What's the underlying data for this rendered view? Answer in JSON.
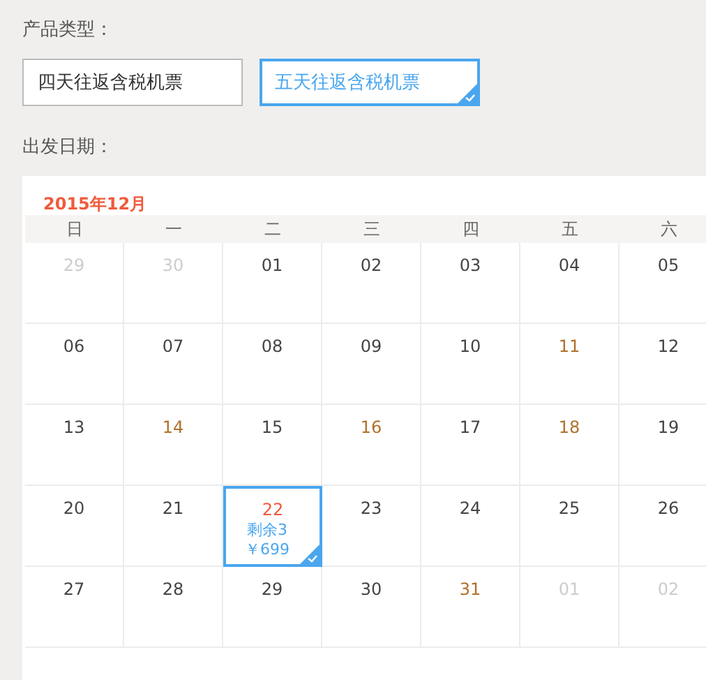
{
  "product_label": "产品类型：",
  "products": [
    {
      "label": "四天往返含税机票",
      "selected": false
    },
    {
      "label": "五天往返含税机票",
      "selected": true
    }
  ],
  "date_label": "出发日期：",
  "calendar": {
    "month": "2015年12月",
    "weekdays": [
      "日",
      "一",
      "二",
      "三",
      "四",
      "五",
      "六"
    ],
    "days": [
      {
        "day": "29",
        "kind": "muted",
        "selected": false
      },
      {
        "day": "30",
        "kind": "muted",
        "selected": false
      },
      {
        "day": "01",
        "kind": "plain",
        "selected": false
      },
      {
        "day": "02",
        "kind": "plain",
        "selected": false
      },
      {
        "day": "03",
        "kind": "plain",
        "selected": false
      },
      {
        "day": "04",
        "kind": "plain",
        "selected": false
      },
      {
        "day": "05",
        "kind": "plain",
        "selected": false
      },
      {
        "day": "06",
        "kind": "plain",
        "selected": false
      },
      {
        "day": "07",
        "kind": "plain",
        "selected": false
      },
      {
        "day": "08",
        "kind": "plain",
        "selected": false
      },
      {
        "day": "09",
        "kind": "plain",
        "selected": false
      },
      {
        "day": "10",
        "kind": "plain",
        "selected": false
      },
      {
        "day": "11",
        "kind": "accent",
        "selected": false
      },
      {
        "day": "12",
        "kind": "plain",
        "selected": false
      },
      {
        "day": "13",
        "kind": "plain",
        "selected": false
      },
      {
        "day": "14",
        "kind": "accent",
        "selected": false
      },
      {
        "day": "15",
        "kind": "plain",
        "selected": false
      },
      {
        "day": "16",
        "kind": "accent",
        "selected": false
      },
      {
        "day": "17",
        "kind": "plain",
        "selected": false
      },
      {
        "day": "18",
        "kind": "accent",
        "selected": false
      },
      {
        "day": "19",
        "kind": "plain",
        "selected": false
      },
      {
        "day": "20",
        "kind": "plain",
        "selected": false
      },
      {
        "day": "21",
        "kind": "plain",
        "selected": false
      },
      {
        "day": "22",
        "kind": "available",
        "selected": true,
        "remaining": "剩余3",
        "price": "￥699"
      },
      {
        "day": "23",
        "kind": "plain",
        "selected": false
      },
      {
        "day": "24",
        "kind": "plain",
        "selected": false
      },
      {
        "day": "25",
        "kind": "plain",
        "selected": false
      },
      {
        "day": "26",
        "kind": "plain",
        "selected": false
      },
      {
        "day": "27",
        "kind": "plain",
        "selected": false
      },
      {
        "day": "28",
        "kind": "plain",
        "selected": false
      },
      {
        "day": "29",
        "kind": "plain",
        "selected": false
      },
      {
        "day": "30",
        "kind": "plain",
        "selected": false
      },
      {
        "day": "31",
        "kind": "accent",
        "selected": false
      },
      {
        "day": "01",
        "kind": "muted",
        "selected": false
      },
      {
        "day": "02",
        "kind": "muted",
        "selected": false
      }
    ]
  }
}
